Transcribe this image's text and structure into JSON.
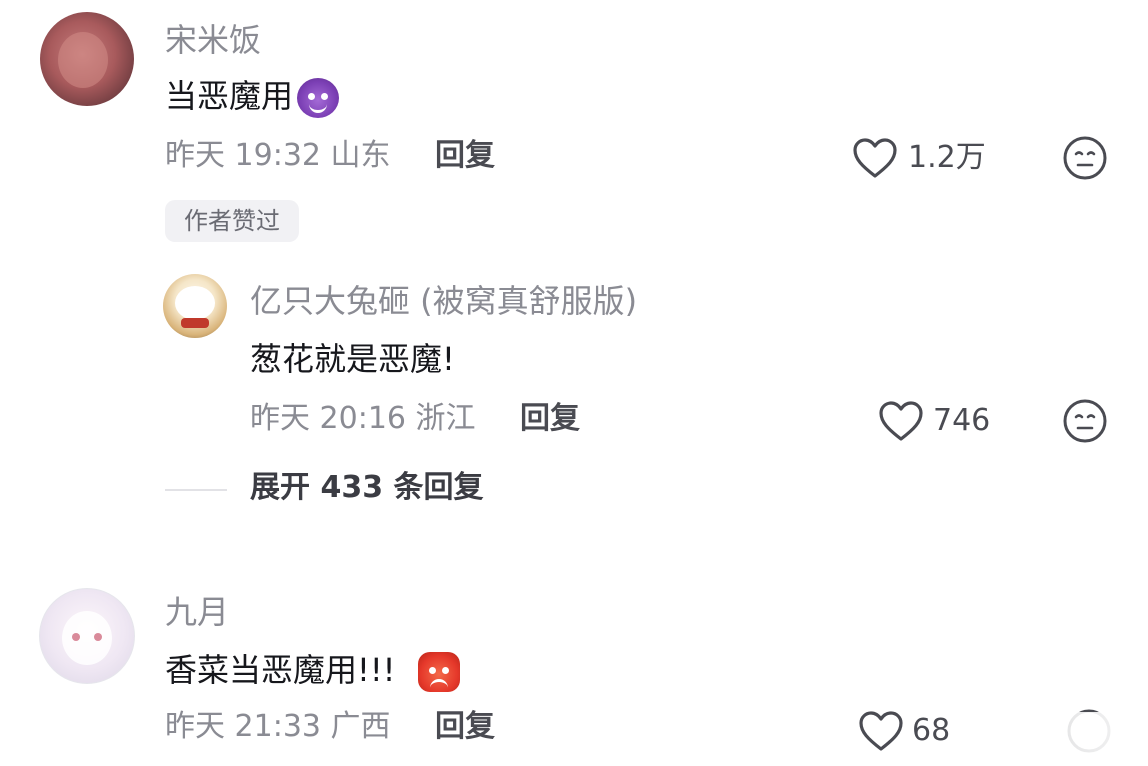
{
  "comments": [
    {
      "username": "宋米饭",
      "text": "当恶魔用",
      "emoji": "smiling-devil-emoji",
      "time": "昨天 19:32",
      "location": "山东",
      "reply_label": "回复",
      "likes": "1.2万",
      "badge": "作者赞过"
    },
    {
      "username": "亿只大兔砸 (被窝真舒服版)",
      "text": "葱花就是恶魔!",
      "time": "昨天 20:16",
      "location": "浙江",
      "reply_label": "回复",
      "likes": "746"
    },
    {
      "username": "九月",
      "text": "香菜当恶魔用!!!",
      "emoji": "angry-devil-emoji",
      "time": "昨天 21:33",
      "location": "广西",
      "reply_label": "回复",
      "likes": "68"
    }
  ],
  "expand_replies": "展开 433 条回复",
  "colors": {
    "text_primary": "#16171c",
    "text_secondary": "#8a8b93",
    "badge_bg": "#f1f1f4"
  }
}
